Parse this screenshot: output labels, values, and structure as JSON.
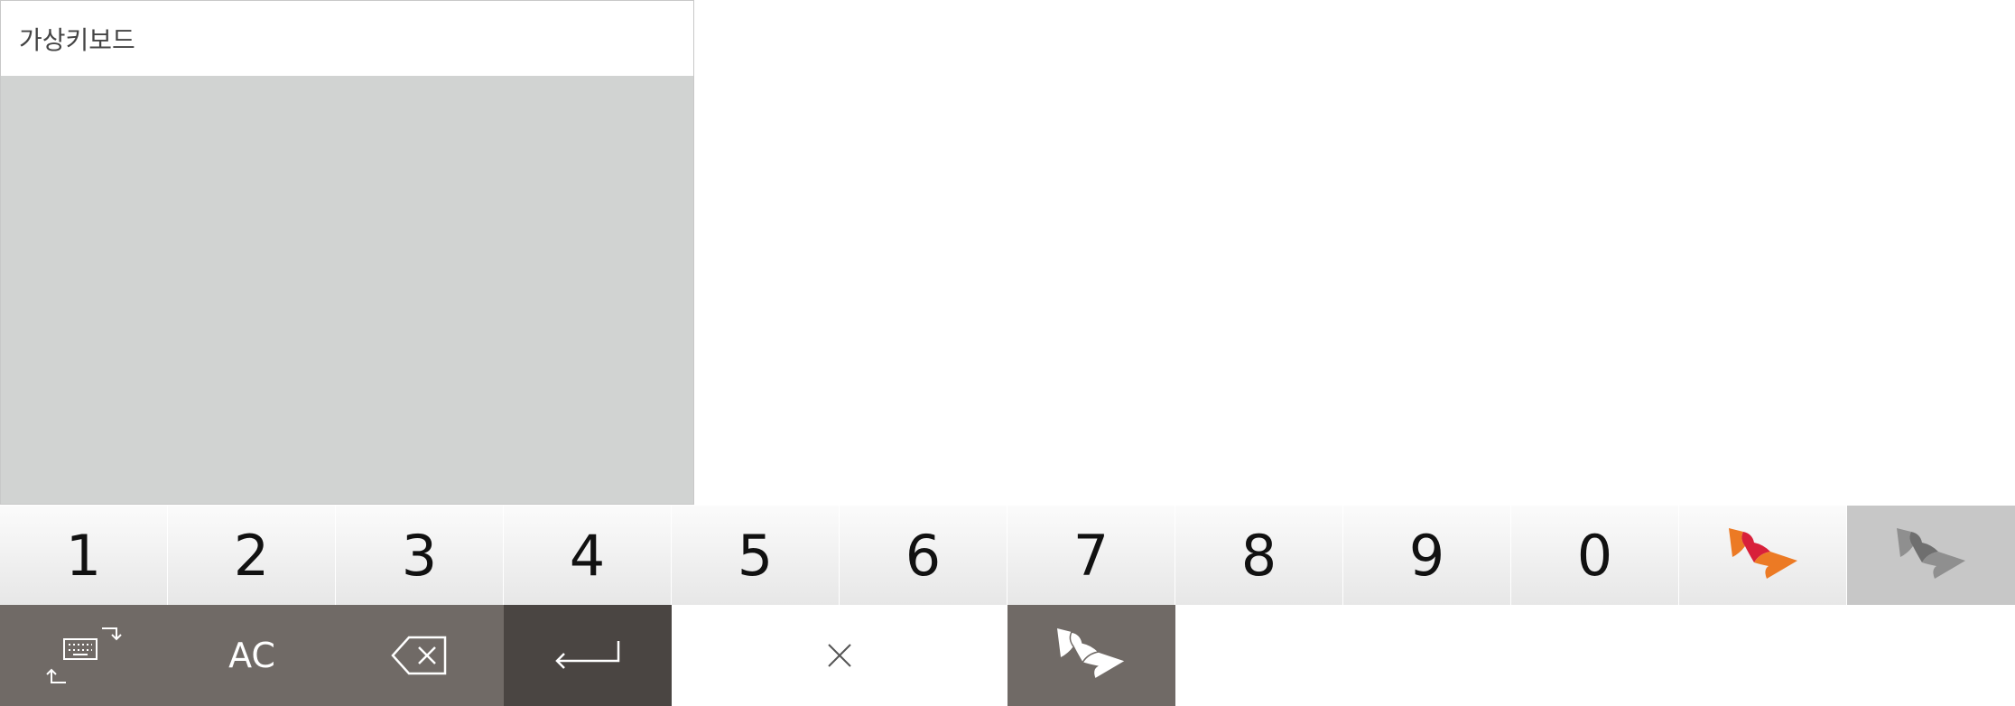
{
  "panel": {
    "title": "가상키보드"
  },
  "number_row": [
    "1",
    "2",
    "3",
    "4",
    "5",
    "6",
    "7",
    "8",
    "9",
    "0"
  ],
  "function_row": {
    "ac_label": "AC"
  },
  "colors": {
    "panel_bg": "#d1d3d2",
    "key_dark": "#706a66",
    "key_enter": "#4a4542",
    "key_active": "#c7c7c7",
    "logo_orange": "#ec7a24",
    "logo_red": "#d8203a"
  },
  "icons": {
    "keyboard_switch": "keyboard-switch-icon",
    "backspace": "backspace-icon",
    "enter": "enter-icon",
    "close": "close-icon",
    "logo": "sk-butterfly-logo"
  }
}
